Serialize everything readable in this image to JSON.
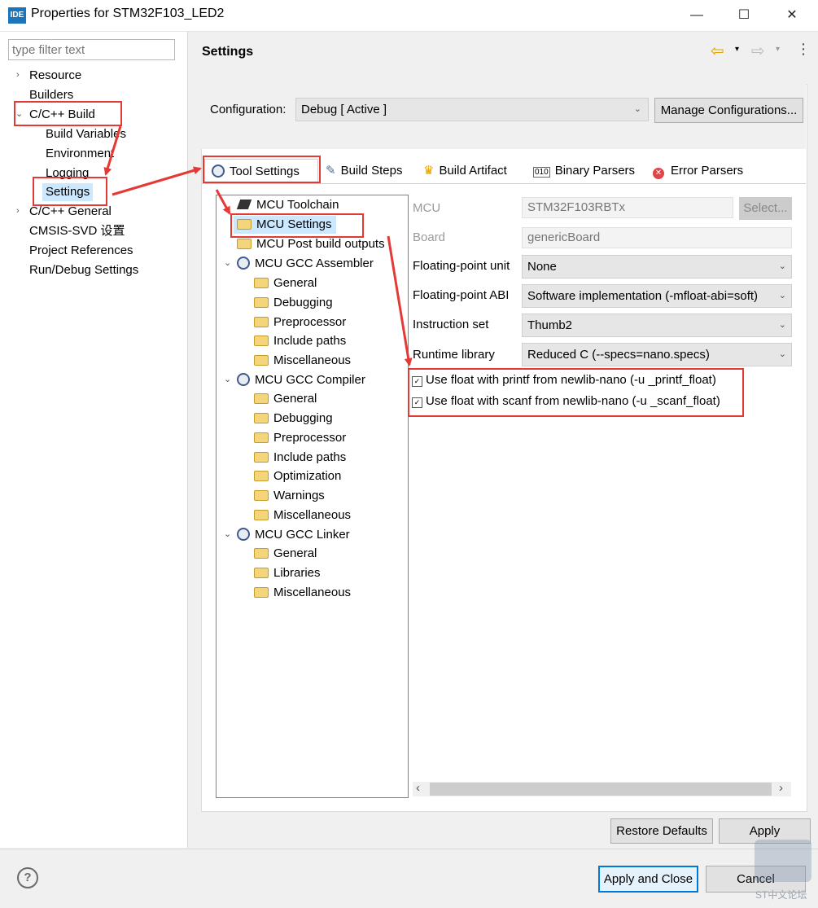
{
  "window": {
    "icon_text": "IDE",
    "title": "Properties for STM32F103_LED2",
    "controls": {
      "minimize": "—",
      "maximize": "☐",
      "close": "✕"
    }
  },
  "filter": {
    "placeholder": "type filter text"
  },
  "nav": {
    "resource": "Resource",
    "builders": "Builders",
    "cpp_build": "C/C++ Build",
    "build_variables": "Build Variables",
    "environment": "Environment",
    "logging": "Logging",
    "settings": "Settings",
    "cpp_general": "C/C++ General",
    "cmsis_svd": "CMSIS-SVD 设置",
    "project_references": "Project References",
    "run_debug": "Run/Debug Settings"
  },
  "page": {
    "title": "Settings"
  },
  "config": {
    "label": "Configuration:",
    "value": "Debug  [ Active ]",
    "manage_button": "Manage Configurations..."
  },
  "tabs": {
    "tool_settings": "Tool Settings",
    "build_steps": "Build Steps",
    "build_artifact": "Build Artifact",
    "binary_parsers": "Binary Parsers",
    "error_parsers": "Error Parsers"
  },
  "tree": {
    "mcu_toolchain": "MCU Toolchain",
    "mcu_settings": "MCU Settings",
    "mcu_post_build": "MCU Post build outputs",
    "assembler": {
      "label": "MCU GCC Assembler",
      "children": [
        "General",
        "Debugging",
        "Preprocessor",
        "Include paths",
        "Miscellaneous"
      ]
    },
    "compiler": {
      "label": "MCU GCC Compiler",
      "children": [
        "General",
        "Debugging",
        "Preprocessor",
        "Include paths",
        "Optimization",
        "Warnings",
        "Miscellaneous"
      ]
    },
    "linker": {
      "label": "MCU GCC Linker",
      "children": [
        "General",
        "Libraries",
        "Miscellaneous"
      ]
    }
  },
  "mcu_settings": {
    "mcu_label": "MCU",
    "mcu_value": "STM32F103RBTx",
    "select_button": "Select...",
    "board_label": "Board",
    "board_value": "genericBoard",
    "fpu_label": "Floating-point unit",
    "fpu_value": "None",
    "abi_label": "Floating-point ABI",
    "abi_value": "Software implementation (-mfloat-abi=soft)",
    "iset_label": "Instruction set",
    "iset_value": "Thumb2",
    "runtime_label": "Runtime library",
    "runtime_value": "Reduced C (--specs=nano.specs)",
    "printf_float": "Use float with printf from newlib-nano (-u _printf_float)",
    "scanf_float": "Use float with scanf from newlib-nano (-u _scanf_float)"
  },
  "scrollbar": {
    "left": "‹",
    "right": "›"
  },
  "buttons": {
    "restore_defaults": "Restore Defaults",
    "apply": "Apply",
    "apply_and_close": "Apply and Close",
    "cancel": "Cancel"
  },
  "help": {
    "glyph": "?"
  },
  "watermark": "ST中文论坛",
  "colors": {
    "highlight_box": "#e53935",
    "selection": "#cce8ff",
    "button_focus": "#0078d7"
  }
}
